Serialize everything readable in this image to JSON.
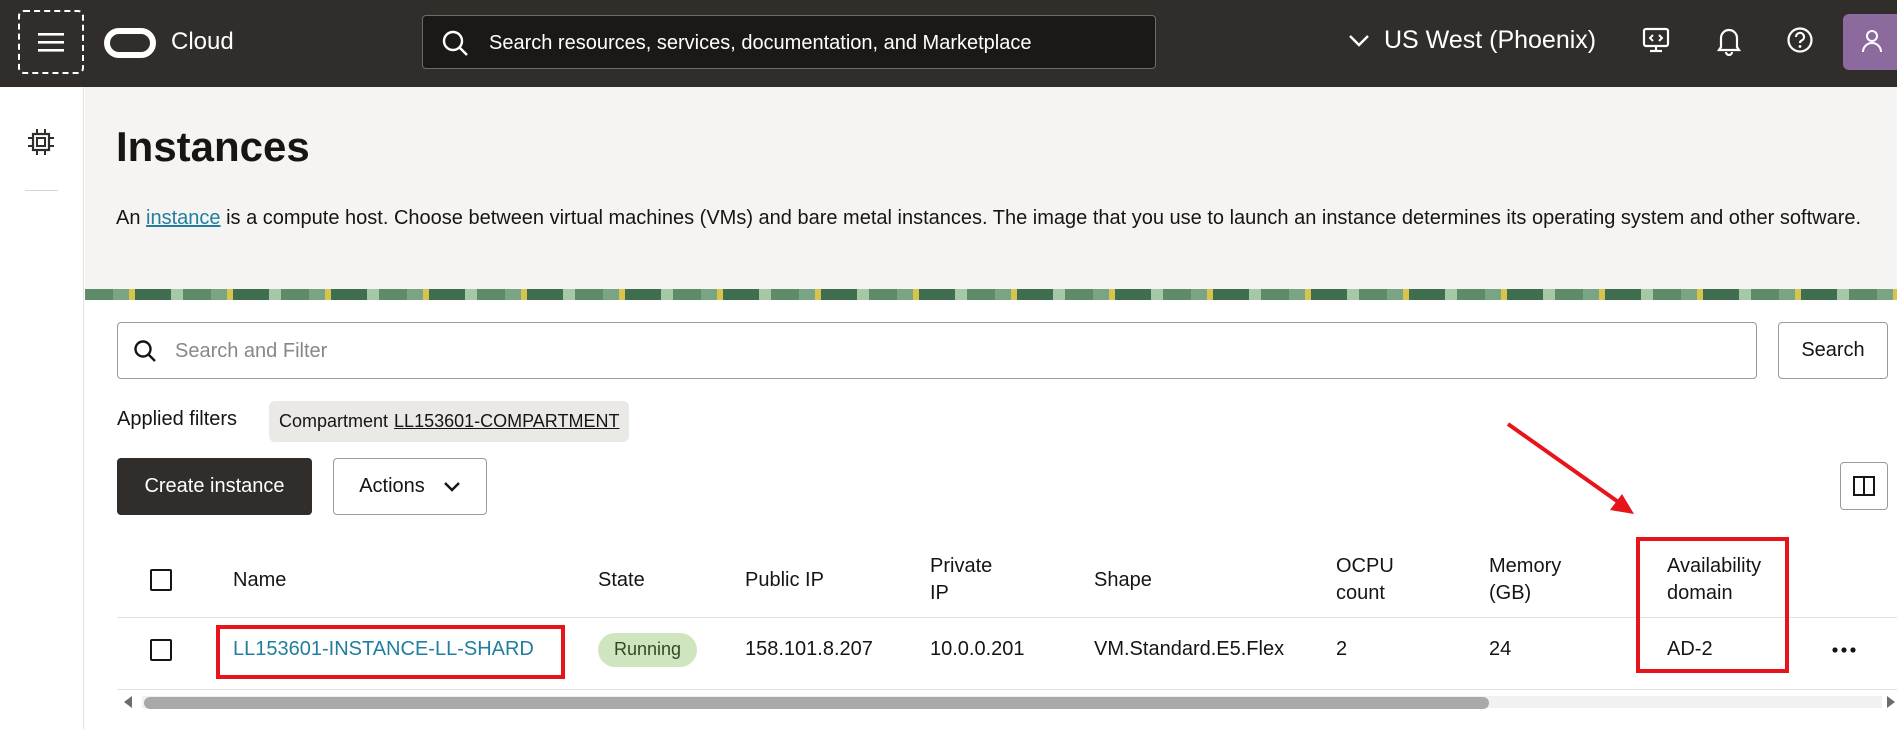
{
  "header": {
    "brand": "Cloud",
    "search_placeholder": "Search resources, services, documentation, and Marketplace",
    "region": "US West (Phoenix)"
  },
  "page": {
    "title": "Instances",
    "desc_prefix": "An ",
    "desc_link": "instance",
    "desc_suffix": " is a compute host. Choose between virtual machines (VMs) and bare metal instances. The image that you use to launch an instance determines its operating system and other software."
  },
  "filters": {
    "search_placeholder": "Search and Filter",
    "search_button": "Search",
    "applied_label": "Applied filters",
    "chip_key": "Compartment",
    "chip_value": "LL153601-COMPARTMENT"
  },
  "toolbar": {
    "create_label": "Create instance",
    "actions_label": "Actions"
  },
  "table": {
    "headers": {
      "name": "Name",
      "state": "State",
      "public_ip": "Public IP",
      "private_ip_1": "Private",
      "private_ip_2": "IP",
      "shape": "Shape",
      "ocpu_1": "OCPU",
      "ocpu_2": "count",
      "memory_1": "Memory",
      "memory_2": "(GB)",
      "ad_1": "Availability",
      "ad_2": "domain"
    },
    "rows": [
      {
        "name": "LL153601-INSTANCE-LL-SHARD",
        "state": "Running",
        "public_ip": "158.101.8.207",
        "private_ip": "10.0.0.201",
        "shape": "VM.Standard.E5.Flex",
        "ocpu": "2",
        "memory": "24",
        "ad": "AD-2"
      }
    ]
  },
  "colors": {
    "header_bg": "#312d2a",
    "link": "#227e9e",
    "running_badge": "#cfe5c0",
    "annotation": "#e8141c"
  },
  "icons": [
    "hamburger-icon",
    "oracle-logo",
    "search-icon",
    "chevron-down-icon",
    "developer-tools-icon",
    "bell-icon",
    "help-icon",
    "user-avatar",
    "compute-chip-icon",
    "columns-icon",
    "more-icon"
  ]
}
